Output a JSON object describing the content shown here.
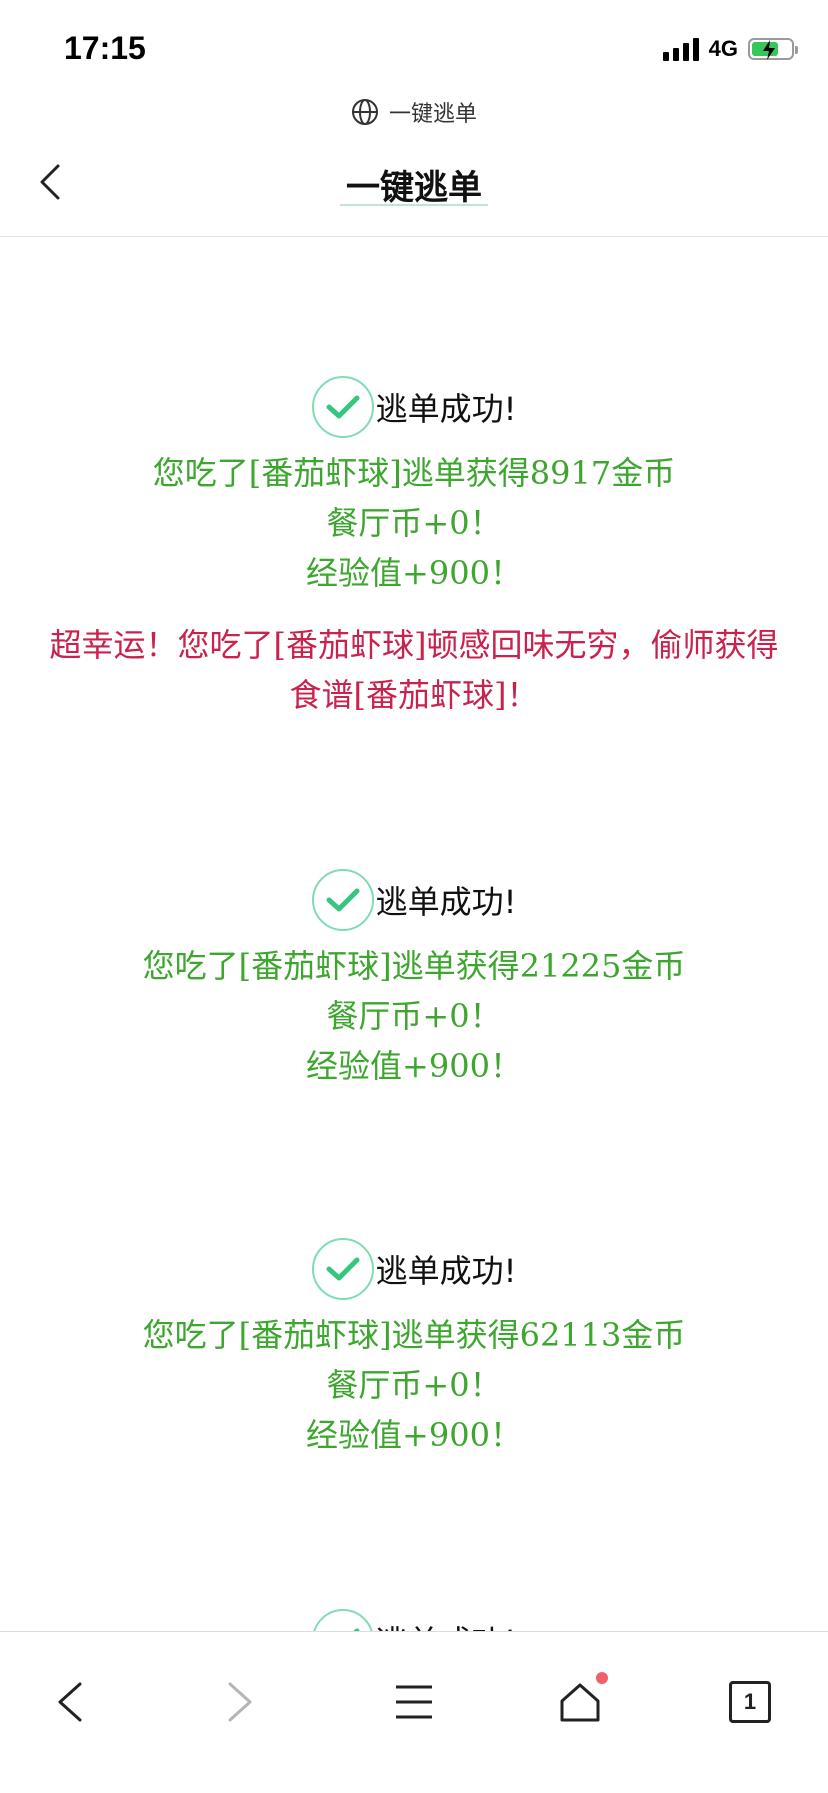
{
  "status": {
    "time": "17:15",
    "network": "4G"
  },
  "browser": {
    "url_title": "一键逃单",
    "tab_count": "1"
  },
  "header": {
    "title": "一键逃单"
  },
  "results": [
    {
      "title": "逃单成功!",
      "line1": "您吃了[番茄虾球]逃单获得8917金币",
      "line2": "餐厅币+0！",
      "line3": "经验值+900！",
      "bonus": "超幸运！您吃了[番茄虾球]顿感回味无穷，偷师获得食谱[番茄虾球]！"
    },
    {
      "title": "逃单成功!",
      "line1": "您吃了[番茄虾球]逃单获得21225金币",
      "line2": "餐厅币+0！",
      "line3": "经验值+900！"
    },
    {
      "title": "逃单成功!",
      "line1": "您吃了[番茄虾球]逃单获得62113金币",
      "line2": "餐厅币+0！",
      "line3": "经验值+900！"
    },
    {
      "title": "逃单成功!"
    }
  ],
  "colors": {
    "success_text": "#3da62e",
    "bonus_text": "#c8224d",
    "check_ring": "#7fdcb3",
    "check_mark": "#35c77e"
  }
}
